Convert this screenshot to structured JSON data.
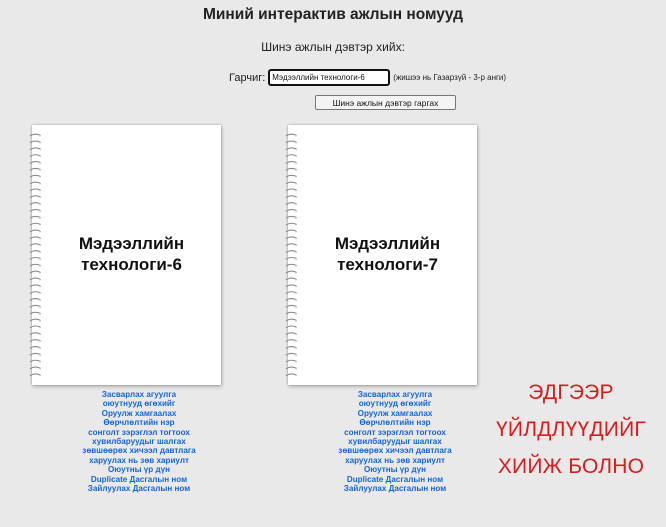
{
  "header": {
    "title": "Миний интерактив ажлын номууд",
    "subtitle": "Шинэ ажлын дэвтэр хийх:"
  },
  "form": {
    "label": "Гарчиг:",
    "input_value": "Мэдээллийн технологи-6",
    "hint": "(жишээ нь Газарзүй - 3-р анги)",
    "button_label": "Шинэ ажлын дэвтэр гаргах"
  },
  "notebooks": [
    {
      "title_line1": "Мэдээллийн",
      "title_line2": "технологи-6",
      "menu": [
        "Засварлах агуулга",
        "оюутнууд өгөхийг",
        "Оруулж хамгаалах",
        "Өөрчлөлтийн нэр",
        "сонголт зэрэглэл тогтоох",
        "хувилбаруудыг шалгах",
        "зөвшөөрөх хичээл давтлага",
        "харуулах нь зөв хариулт",
        "Оюутны үр дүн",
        "Duplicate Дасгалын ном",
        "Зайлуулах Дасгалын ном"
      ]
    },
    {
      "title_line1": "Мэдээллийн",
      "title_line2": "технологи-7",
      "menu": [
        "Засварлах агуулга",
        "оюутнууд өгөхийг",
        "Оруулж хамгаалах",
        "Өөрчлөлтийн нэр",
        "сонголт зэрэглэл тогтоох",
        "хувилбаруудыг шалгах",
        "зөвшөөрөх хичээл давтлага",
        "харуулах нь зөв хариулт",
        "Оюутны үр дүн",
        "Duplicate Дасгалын ном",
        "Зайлуулах Дасгалын ном"
      ]
    }
  ],
  "callout": {
    "line1": "ЭДГЭЭР",
    "line2": "ҮЙЛДЛҮҮДИЙГ",
    "line3": "ХИЙЖ БОЛНО"
  },
  "colors": {
    "background": "#e9e9e9",
    "link": "#1565d8",
    "callout": "#d81c1c"
  },
  "icons": {
    "notebook_binding": "spiral-binding-icon"
  }
}
